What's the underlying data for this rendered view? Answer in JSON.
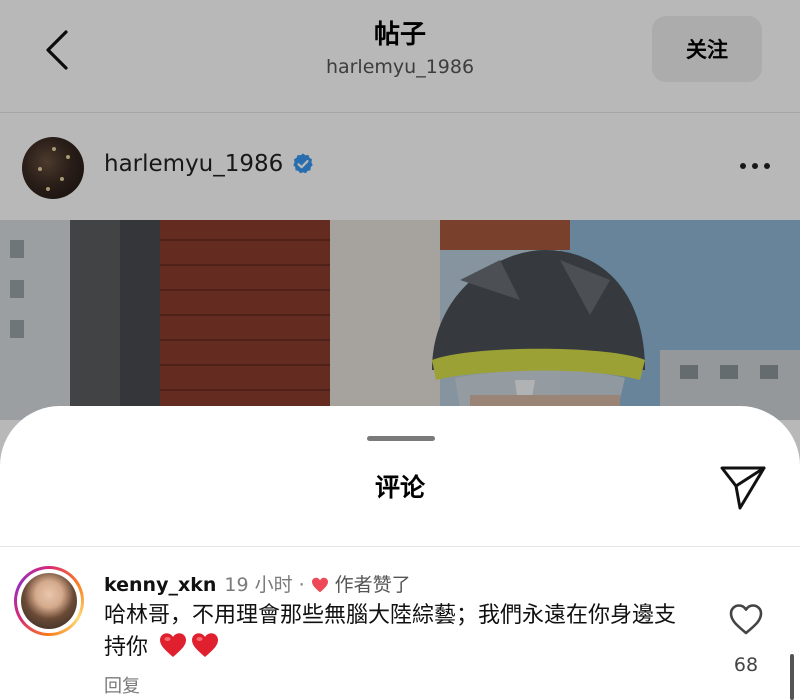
{
  "header": {
    "title": "帖子",
    "subtitle": "harlemyu_1986",
    "follow_label": "关注"
  },
  "post": {
    "author": "harlemyu_1986"
  },
  "comments_sheet": {
    "title": "评论",
    "comment": {
      "username": "kenny_xkn",
      "time": "19 小时",
      "separator": "·",
      "liked_by_author": "作者赞了",
      "text": "哈林哥，不用理會那些無腦大陸綜藝；我們永遠在你身邊支持你",
      "reply_label": "回复",
      "like_count": "68"
    }
  },
  "colors": {
    "follow_bg": "#efefef",
    "verified": "#3897f0",
    "heart_red": "#ed4956",
    "muted_text": "#7a7a7a"
  },
  "icons": {
    "back": "chevron-left-icon",
    "verified": "verified-badge-icon",
    "more": "more-horizontal-icon",
    "share": "send-icon",
    "like": "heart-outline-icon"
  }
}
